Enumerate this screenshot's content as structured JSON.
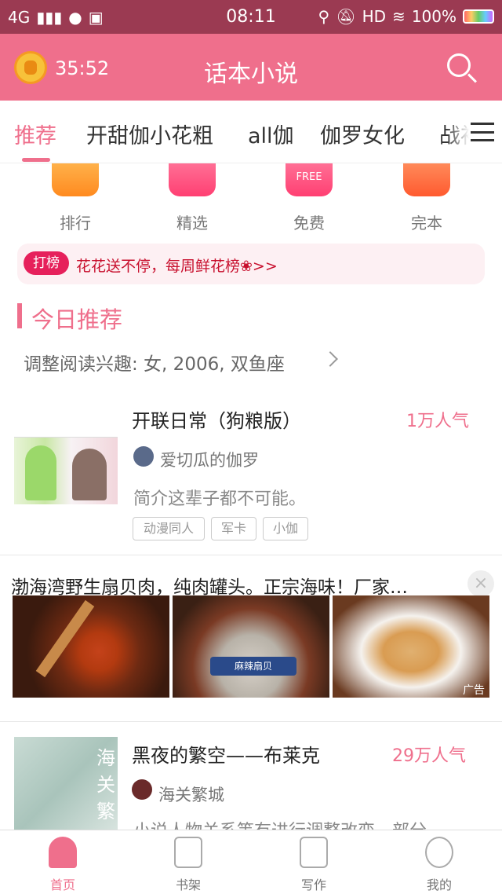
{
  "status_bar": {
    "network": "4G",
    "time": "08:11",
    "hd": "HD",
    "battery": "100%"
  },
  "header": {
    "title": "话本小说",
    "timer": "35:52"
  },
  "tabs": [
    {
      "label": "推荐"
    },
    {
      "label": "开甜伽小花粗"
    },
    {
      "label": "all伽"
    },
    {
      "label": "伽罗女化"
    },
    {
      "label": "战衫"
    }
  ],
  "categories": [
    {
      "label": "排行"
    },
    {
      "label": "精选"
    },
    {
      "label": "免费"
    },
    {
      "label": "完本"
    }
  ],
  "free_badge": "FREE",
  "banner": {
    "tag": "打榜",
    "text": "花花送不停，每周鲜花榜❀>>"
  },
  "section": {
    "title": "今日推荐",
    "adjust_text": "调整阅读兴趣: 女, 2006, 双鱼座"
  },
  "books": [
    {
      "title": "开联日常（狗粮版）",
      "popularity": "1万人气",
      "author": "爱切瓜的伽罗",
      "intro": "简介这辈子都不可能。",
      "tags": [
        "动漫同人",
        "军卡",
        "小伽"
      ]
    },
    {
      "title": "黑夜的繁空——布莱克",
      "popularity": "29万人气",
      "author": "海关繁城",
      "intro": "小说人物关系等有进行调整改变，部分…",
      "cover_text": "海关繁"
    }
  ],
  "ad": {
    "title": "渤海湾野生扇贝肉，纯肉罐头。正宗海味！厂家…",
    "close": "×",
    "label": "广告",
    "can_text": "麻辣扇贝"
  },
  "bottom_nav": [
    {
      "label": "首页"
    },
    {
      "label": "书架"
    },
    {
      "label": "写作"
    },
    {
      "label": "我的"
    }
  ],
  "colors": {
    "accent": "#ef6f8c",
    "status_bar": "#9b3a52"
  }
}
